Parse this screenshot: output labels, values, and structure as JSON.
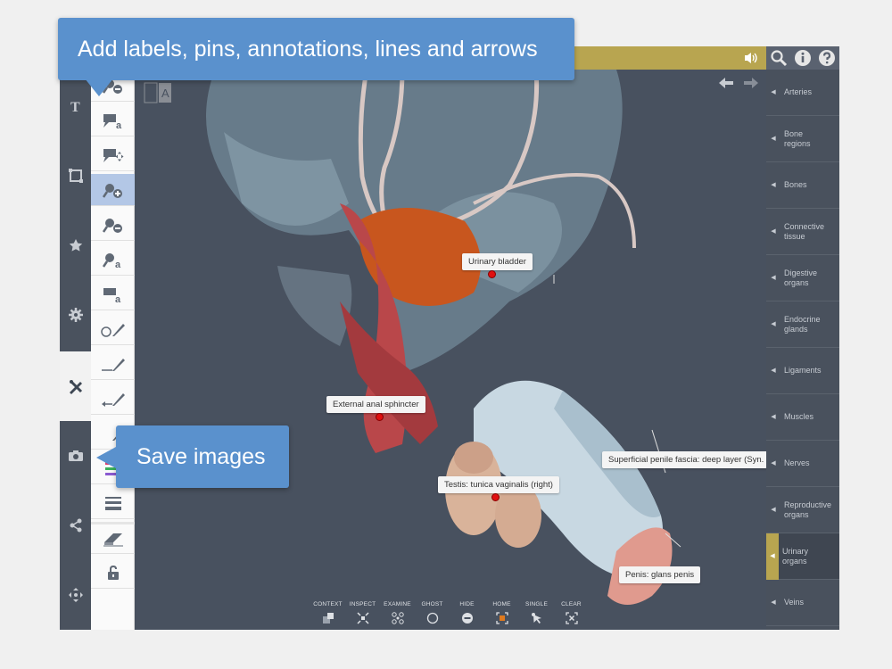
{
  "callouts": {
    "top": "Add labels, pins, annotations, lines and arrows",
    "save": "Save images"
  },
  "left_sidebar": {
    "items": [
      "text-icon",
      "frame-icon",
      "star-icon",
      "gear-icon",
      "annotate-icon",
      "camera-icon",
      "share-icon",
      "move-icon"
    ],
    "active": "annotate-icon"
  },
  "tools": [
    "pin-remove-icon",
    "label-text-icon",
    "label-move-icon",
    "pin-add-icon",
    "pin-delete-icon",
    "pin-label-icon",
    "note-label-icon",
    "circle-draw-icon",
    "line-draw-icon",
    "arrow-draw-icon",
    "eraser-icon",
    "color-swatches-icon",
    "line-weight-icon",
    "clear-icon",
    "unlock-icon"
  ],
  "viewport": {
    "labels": {
      "urinary_bladder": "Urinary bladder",
      "external_anal_sphincter": "External anal sphincter",
      "superficial_penile_fascia": "Superficial penile fascia: deep layer (Syn. Buck",
      "testis": "Testis: tunica vaginalis (right)",
      "penis": "Penis: glans penis"
    }
  },
  "bottom_toolbar": {
    "items": [
      "CONTEXT",
      "INSPECT",
      "EXAMINE",
      "GHOST",
      "HIDE",
      "HOME",
      "SINGLE",
      "CLEAR"
    ]
  },
  "right_sidebar": {
    "items": [
      {
        "line1": "Arteries",
        "line2": ""
      },
      {
        "line1": "Bone",
        "line2": "regions"
      },
      {
        "line1": "Bones",
        "line2": ""
      },
      {
        "line1": "Connective",
        "line2": "tissue"
      },
      {
        "line1": "Digestive",
        "line2": "organs"
      },
      {
        "line1": "Endocrine",
        "line2": "glands"
      },
      {
        "line1": "Ligaments",
        "line2": ""
      },
      {
        "line1": "Muscles",
        "line2": ""
      },
      {
        "line1": "Nerves",
        "line2": ""
      },
      {
        "line1": "Reproductive",
        "line2": "organs"
      },
      {
        "line1": "Urinary",
        "line2": "organs"
      },
      {
        "line1": "Veins",
        "line2": ""
      }
    ],
    "active_index": 10
  },
  "colors": {
    "accent": "#b8a550",
    "callout": "#5a91cd",
    "background": "#48515f",
    "pin": "#e01010"
  }
}
